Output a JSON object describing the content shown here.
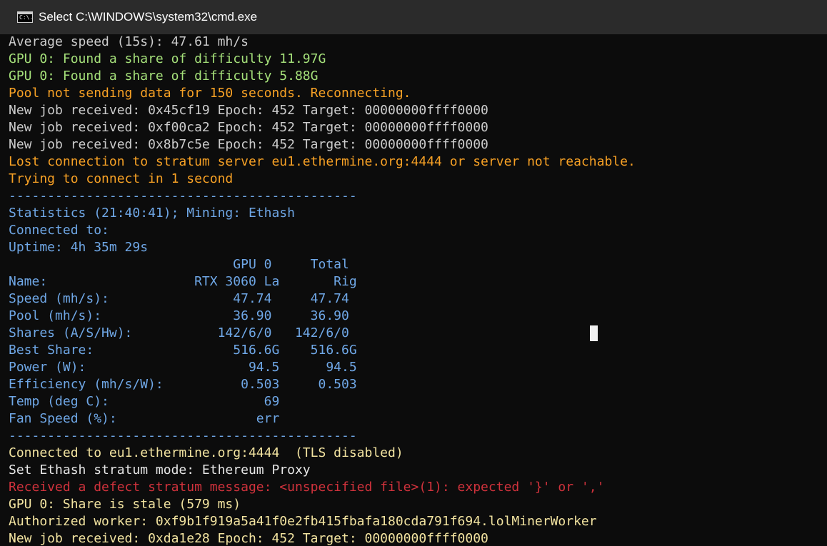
{
  "window": {
    "title": "Select C:\\WINDOWS\\system32\\cmd.exe",
    "icon_text": "C:\\."
  },
  "lines": [
    {
      "color": "gray",
      "text": "Average speed (15s): 47.61 mh/s"
    },
    {
      "color": "green",
      "text": "GPU 0: Found a share of difficulty 11.97G"
    },
    {
      "color": "green",
      "text": "GPU 0: Found a share of difficulty 5.88G"
    },
    {
      "color": "orange",
      "text": "Pool not sending data for 150 seconds. Reconnecting."
    },
    {
      "color": "gray",
      "text": "New job received: 0x45cf19 Epoch: 452 Target: 00000000ffff0000"
    },
    {
      "color": "gray",
      "text": "New job received: 0xf00ca2 Epoch: 452 Target: 00000000ffff0000"
    },
    {
      "color": "gray",
      "text": "New job received: 0x8b7c5e Epoch: 452 Target: 00000000ffff0000"
    },
    {
      "color": "orange",
      "text": "Lost connection to stratum server eu1.ethermine.org:4444 or server not reachable."
    },
    {
      "color": "orange",
      "text": "Trying to connect in 1 second"
    },
    {
      "color": "blue",
      "text": "---------------------------------------------"
    },
    {
      "color": "blue",
      "text": "Statistics (21:40:41); Mining: Ethash"
    },
    {
      "color": "blue",
      "text": "Connected to:"
    },
    {
      "color": "blue",
      "text": "Uptime: 4h 35m 29s"
    },
    {
      "color": "blue",
      "text": "                             GPU 0     Total"
    },
    {
      "color": "blue",
      "text": "Name:                   RTX 3060 La       Rig"
    },
    {
      "color": "blue",
      "text": "Speed (mh/s):                47.74     47.74"
    },
    {
      "color": "blue",
      "text": "Pool (mh/s):                 36.90     36.90"
    },
    {
      "color": "blue",
      "text": "Shares (A/S/Hw):           142/6/0   142/6/0"
    },
    {
      "color": "blue",
      "text": "Best Share:                  516.6G    516.6G"
    },
    {
      "color": "blue",
      "text": "Power (W):                     94.5      94.5"
    },
    {
      "color": "blue",
      "text": "Efficiency (mh/s/W):          0.503     0.503"
    },
    {
      "color": "blue",
      "text": "Temp (deg C):                    69"
    },
    {
      "color": "blue",
      "text": "Fan Speed (%):                  err"
    },
    {
      "color": "blue",
      "text": "---------------------------------------------"
    },
    {
      "color": "yellow",
      "text": "Connected to eu1.ethermine.org:4444  (TLS disabled)"
    },
    {
      "color": "white",
      "text": "Set Ethash stratum mode: Ethereum Proxy"
    },
    {
      "color": "red",
      "text": "Received a defect stratum message: <unspecified file>(1): expected '}' or ','"
    },
    {
      "color": "yellow",
      "text": "GPU 0: Share is stale (579 ms)"
    },
    {
      "color": "yellow",
      "text": "Authorized worker: 0xf9b1f919a5a41f0e2fb415fbafa180cda791f694.lolMinerWorker"
    },
    {
      "color": "yellow",
      "text": "New job received: 0xda1e28 Epoch: 452 Target: 00000000ffff0000"
    }
  ]
}
